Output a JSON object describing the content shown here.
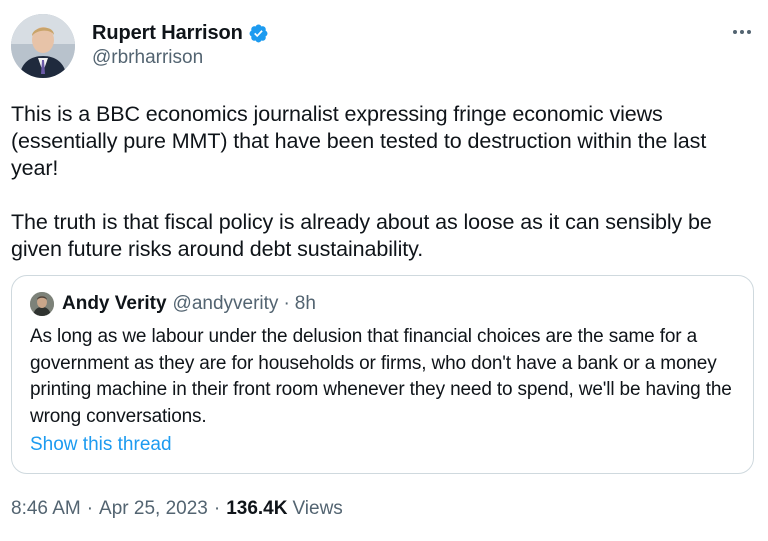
{
  "author": {
    "name": "Rupert Harrison",
    "handle": "@rbrharrison",
    "verified_color": "#1d9bf0"
  },
  "tweet": {
    "text": "This is a BBC economics journalist expressing fringe economic views (essentially pure MMT) that have been tested to destruction within the last year!\n\nThe truth is that fiscal policy is already about as loose as it can sensibly be given future risks around debt sustainability."
  },
  "quoted_tweet": {
    "name": "Andy Verity",
    "handle": "@andyverity",
    "separator": "·",
    "time": "8h",
    "text": "As long as we labour under the delusion that financial choices are the same for a government as they are for households or firms, who don't have a bank or a money printing machine in their front room whenever they need to spend, we'll be having the wrong conversations.",
    "link_label": "Show this thread",
    "link_color": "#1d9bf0"
  },
  "meta": {
    "time": "8:46 AM",
    "separator": "·",
    "date": "Apr 25, 2023",
    "views_count": "136.4K",
    "views_label": "Views"
  },
  "icons": {
    "more": "more-horizontal-icon",
    "verified": "verified-badge-icon"
  }
}
